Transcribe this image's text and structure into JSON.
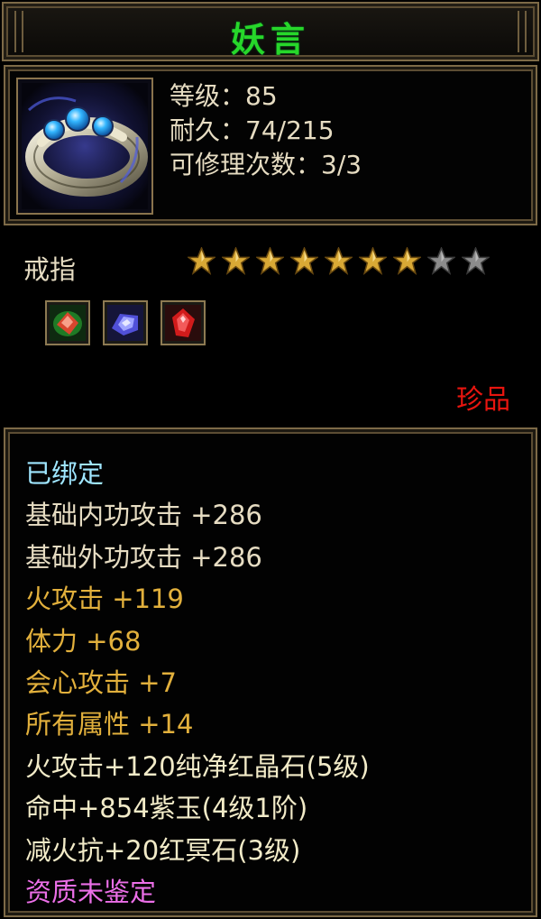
{
  "title": "妖言",
  "item": {
    "icon": "ring-icon",
    "stats": [
      "等级：85",
      "耐久：74/215",
      "可修理次数：3/3"
    ],
    "type": "戒指",
    "stars_total": 9,
    "stars_filled": 7,
    "sockets": [
      {
        "name": "red-gem-icon",
        "color": "#d8462e"
      },
      {
        "name": "purple-gem-icon",
        "color": "#5050d8"
      },
      {
        "name": "red-crystal-icon",
        "color": "#d11b1b"
      }
    ],
    "rarity": "珍品",
    "rarity_color": "#e8150f"
  },
  "attributes": [
    {
      "text": "已绑定",
      "color": "#9fe6ff"
    },
    {
      "text": "基础内功攻击 +286",
      "color": "#e6dcc2"
    },
    {
      "text": "基础外功攻击 +286",
      "color": "#e6dcc2"
    },
    {
      "text": "火攻击 +119",
      "color": "#e2b03c"
    },
    {
      "text": "体力 +68",
      "color": "#e2b03c"
    },
    {
      "text": "会心攻击 +7",
      "color": "#e2b03c"
    },
    {
      "text": "所有属性 +14",
      "color": "#e2b03c"
    },
    {
      "text": "火攻击+120纯净红晶石(5级)",
      "color": "#f2ebc8"
    },
    {
      "text": "命中+854紫玉(4级1阶)",
      "color": "#f2ebc8"
    },
    {
      "text": "减火抗+20红冥石(3级)",
      "color": "#f2ebc8"
    },
    {
      "text": "资质未鉴定",
      "color": "#ec6fe8"
    }
  ],
  "colors": {
    "title": "#27d72a",
    "border": "#7d6a47",
    "star_filled": "#d9a935",
    "star_empty": "#8c8c8c"
  }
}
